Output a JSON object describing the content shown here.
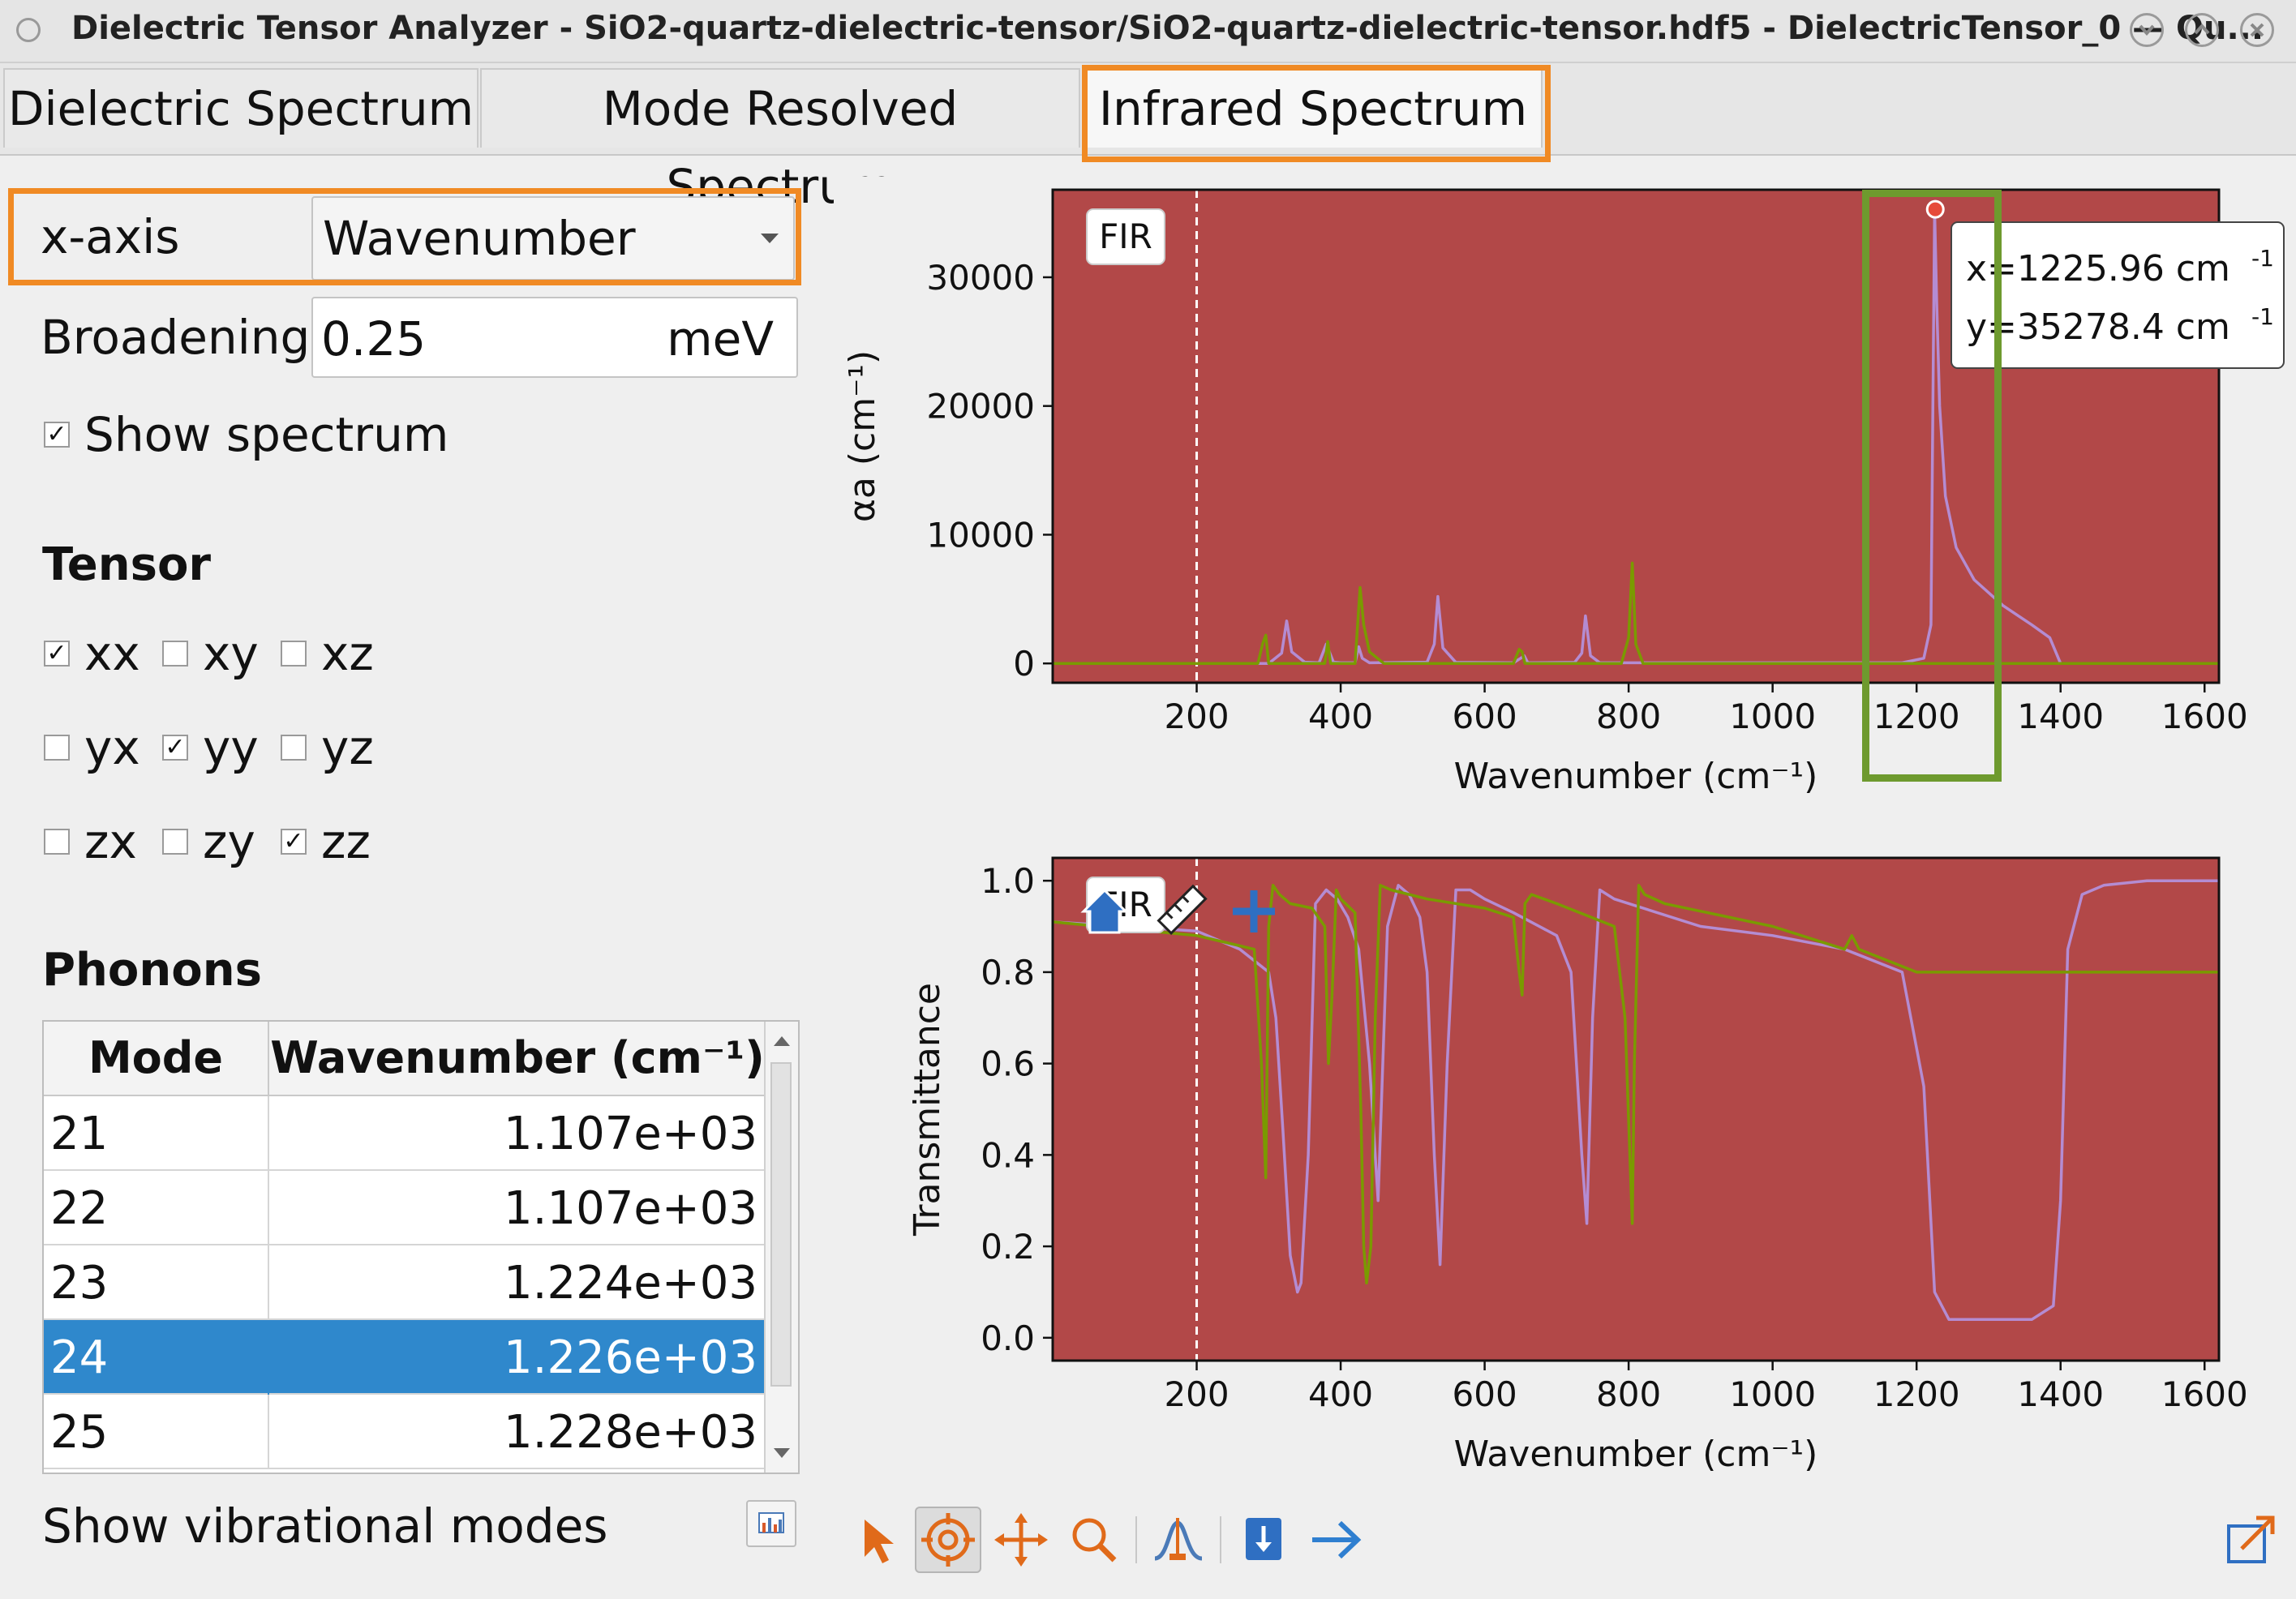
{
  "window": {
    "title": "Dielectric Tensor Analyzer - SiO2-quartz-dielectric-tensor/SiO2-quartz-dielectric-tensor.hdf5 - DielectricTensor_0 — Qu..."
  },
  "tabs": [
    {
      "label": "Dielectric Spectrum"
    },
    {
      "label": "Mode Resolved Spectrum"
    },
    {
      "label": "Infrared Spectrum"
    }
  ],
  "controls": {
    "xaxis_label": "x-axis",
    "xaxis_value": "Wavenumber",
    "broadening_label": "Broadening",
    "broadening_value": "0.25",
    "broadening_unit": "meV",
    "show_spectrum_label": "Show spectrum",
    "show_spectrum_checked": true
  },
  "tensor": {
    "title": "Tensor",
    "components": [
      {
        "label": "xx",
        "checked": true
      },
      {
        "label": "xy",
        "checked": false
      },
      {
        "label": "xz",
        "checked": false
      },
      {
        "label": "yx",
        "checked": false
      },
      {
        "label": "yy",
        "checked": true
      },
      {
        "label": "yz",
        "checked": false
      },
      {
        "label": "zx",
        "checked": false
      },
      {
        "label": "zy",
        "checked": false
      },
      {
        "label": "zz",
        "checked": true
      }
    ]
  },
  "phonons": {
    "title": "Phonons",
    "columns": [
      "Mode",
      "Wavenumber (cm⁻¹)"
    ],
    "rows": [
      {
        "mode": "21",
        "wavenumber": "1.107e+03",
        "selected": false
      },
      {
        "mode": "22",
        "wavenumber": "1.107e+03",
        "selected": false
      },
      {
        "mode": "23",
        "wavenumber": "1.224e+03",
        "selected": false
      },
      {
        "mode": "24",
        "wavenumber": "1.226e+03",
        "selected": true
      },
      {
        "mode": "25",
        "wavenumber": "1.228e+03",
        "selected": false
      }
    ],
    "show_modes_label": "Show vibrational modes"
  },
  "icons": {
    "window_menu": "circle-icon",
    "minimize": "chevron-down-icon",
    "maximize": "chevron-up-icon",
    "close": "close-icon",
    "toolbar": [
      "pointer-icon",
      "crosshair-icon",
      "pan-icon",
      "zoom-icon",
      "peak-icon",
      "download-icon",
      "arrow-right-icon",
      "expand-icon"
    ],
    "overlay": [
      "home-icon",
      "ruler-icon",
      "plus-icon"
    ]
  },
  "colors": {
    "plot_bg": "#b24848",
    "line_purple": "#b48cd2",
    "line_green": "#7a9a00",
    "highlight_orange": "#f08a24",
    "highlight_green": "#6e9a2e",
    "selection_blue": "#2f88cc"
  },
  "chart_data": [
    {
      "type": "line",
      "title": "",
      "annotation": "FIR",
      "xlabel": "Wavenumber (cm⁻¹)",
      "ylabel": "αa (cm⁻¹)",
      "xlim": [
        0,
        1620
      ],
      "ylim": [
        -1500,
        36800
      ],
      "xticks": [
        200,
        400,
        600,
        800,
        1000,
        1200,
        1400,
        1600
      ],
      "yticks": [
        0,
        10000,
        20000,
        30000
      ],
      "marker_x": 200,
      "tooltip": {
        "x_text": "x=1225.96 cm",
        "y_text": "y=35278.4 cm",
        "exp": "-1",
        "x": 1225.96,
        "y": 35278.4
      },
      "series": [
        {
          "color": "#b48cd2",
          "x": [
            0,
            300,
            318,
            325,
            332,
            350,
            370,
            380,
            390,
            400,
            420,
            425,
            430,
            440,
            520,
            530,
            535,
            542,
            560,
            640,
            650,
            655,
            660,
            725,
            735,
            740,
            747,
            760,
            1180,
            1210,
            1220,
            1225,
            1228,
            1232,
            1240,
            1255,
            1280,
            1320,
            1360,
            1385,
            1400,
            1620
          ],
          "y": [
            0,
            0,
            800,
            3300,
            900,
            100,
            50,
            1500,
            100,
            50,
            50,
            1300,
            400,
            50,
            100,
            1500,
            5200,
            1200,
            80,
            50,
            400,
            600,
            50,
            80,
            800,
            3700,
            600,
            50,
            50,
            400,
            3000,
            35278,
            28000,
            20000,
            13000,
            9000,
            6500,
            4500,
            3000,
            2000,
            0,
            0
          ]
        },
        {
          "color": "#7a9a00",
          "x": [
            0,
            285,
            292,
            296,
            300,
            320,
            378,
            382,
            386,
            400,
            420,
            427,
            432,
            440,
            460,
            640,
            648,
            652,
            656,
            790,
            800,
            805,
            810,
            820,
            1620
          ],
          "y": [
            0,
            0,
            1600,
            2200,
            0,
            0,
            0,
            1700,
            0,
            0,
            0,
            5900,
            3000,
            900,
            0,
            0,
            1100,
            900,
            0,
            0,
            2000,
            7800,
            1500,
            0,
            0
          ]
        }
      ]
    },
    {
      "type": "line",
      "title": "",
      "annotation": "FIR",
      "xlabel": "Wavenumber (cm⁻¹)",
      "ylabel": "Transmittance",
      "xlim": [
        0,
        1620
      ],
      "ylim": [
        -0.05,
        1.05
      ],
      "xticks": [
        200,
        400,
        600,
        800,
        1000,
        1200,
        1400,
        1600
      ],
      "yticks": [
        0.0,
        0.2,
        0.4,
        0.6,
        0.8,
        1.0
      ],
      "marker_x": 200,
      "series": [
        {
          "color": "#b48cd2",
          "x": [
            0,
            200,
            260,
            300,
            310,
            320,
            330,
            340,
            345,
            355,
            365,
            380,
            395,
            410,
            425,
            440,
            452,
            465,
            480,
            495,
            510,
            520,
            530,
            538,
            548,
            560,
            580,
            600,
            640,
            700,
            720,
            735,
            742,
            750,
            760,
            780,
            900,
            1000,
            1100,
            1180,
            1210,
            1225,
            1245,
            1300,
            1360,
            1390,
            1400,
            1410,
            1430,
            1460,
            1520,
            1620
          ],
          "y": [
            0.91,
            0.89,
            0.85,
            0.8,
            0.7,
            0.45,
            0.18,
            0.1,
            0.12,
            0.4,
            0.95,
            0.98,
            0.96,
            0.92,
            0.85,
            0.6,
            0.3,
            0.9,
            0.99,
            0.97,
            0.92,
            0.8,
            0.4,
            0.16,
            0.6,
            0.98,
            0.98,
            0.96,
            0.93,
            0.88,
            0.8,
            0.4,
            0.25,
            0.7,
            0.98,
            0.96,
            0.9,
            0.88,
            0.85,
            0.8,
            0.55,
            0.1,
            0.04,
            0.04,
            0.04,
            0.07,
            0.3,
            0.85,
            0.97,
            0.99,
            1.0,
            1.0
          ]
        },
        {
          "color": "#7a9a00",
          "x": [
            0,
            200,
            280,
            290,
            296,
            300,
            306,
            315,
            330,
            360,
            378,
            383,
            388,
            394,
            400,
            420,
            428,
            432,
            436,
            442,
            448,
            455,
            470,
            520,
            600,
            640,
            648,
            652,
            656,
            665,
            700,
            780,
            795,
            805,
            808,
            814,
            822,
            850,
            1000,
            1100,
            1110,
            1120,
            1200,
            1620
          ],
          "y": [
            0.91,
            0.88,
            0.85,
            0.6,
            0.35,
            0.9,
            0.99,
            0.97,
            0.95,
            0.94,
            0.9,
            0.6,
            0.75,
            0.98,
            0.96,
            0.93,
            0.5,
            0.2,
            0.12,
            0.2,
            0.7,
            0.99,
            0.98,
            0.96,
            0.94,
            0.92,
            0.8,
            0.75,
            0.95,
            0.97,
            0.95,
            0.9,
            0.7,
            0.25,
            0.6,
            0.99,
            0.97,
            0.95,
            0.9,
            0.85,
            0.88,
            0.85,
            0.8,
            0.8
          ]
        }
      ]
    }
  ]
}
